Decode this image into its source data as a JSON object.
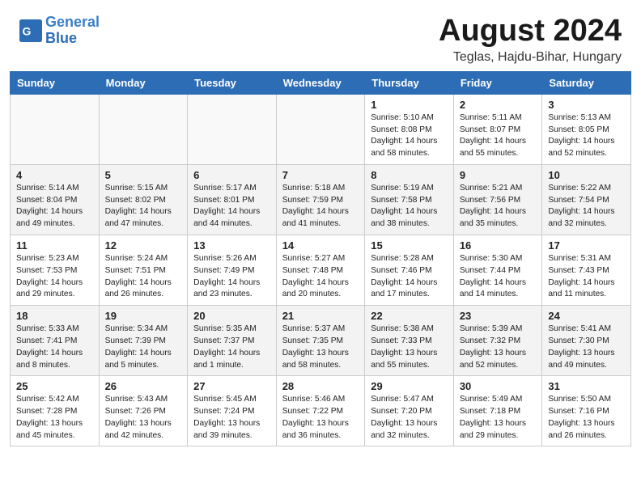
{
  "header": {
    "logo_line1": "General",
    "logo_line2": "Blue",
    "title": "August 2024",
    "subtitle": "Teglas, Hajdu-Bihar, Hungary"
  },
  "weekdays": [
    "Sunday",
    "Monday",
    "Tuesday",
    "Wednesday",
    "Thursday",
    "Friday",
    "Saturday"
  ],
  "weeks": [
    [
      {
        "day": "",
        "info": ""
      },
      {
        "day": "",
        "info": ""
      },
      {
        "day": "",
        "info": ""
      },
      {
        "day": "",
        "info": ""
      },
      {
        "day": "1",
        "info": "Sunrise: 5:10 AM\nSunset: 8:08 PM\nDaylight: 14 hours\nand 58 minutes."
      },
      {
        "day": "2",
        "info": "Sunrise: 5:11 AM\nSunset: 8:07 PM\nDaylight: 14 hours\nand 55 minutes."
      },
      {
        "day": "3",
        "info": "Sunrise: 5:13 AM\nSunset: 8:05 PM\nDaylight: 14 hours\nand 52 minutes."
      }
    ],
    [
      {
        "day": "4",
        "info": "Sunrise: 5:14 AM\nSunset: 8:04 PM\nDaylight: 14 hours\nand 49 minutes."
      },
      {
        "day": "5",
        "info": "Sunrise: 5:15 AM\nSunset: 8:02 PM\nDaylight: 14 hours\nand 47 minutes."
      },
      {
        "day": "6",
        "info": "Sunrise: 5:17 AM\nSunset: 8:01 PM\nDaylight: 14 hours\nand 44 minutes."
      },
      {
        "day": "7",
        "info": "Sunrise: 5:18 AM\nSunset: 7:59 PM\nDaylight: 14 hours\nand 41 minutes."
      },
      {
        "day": "8",
        "info": "Sunrise: 5:19 AM\nSunset: 7:58 PM\nDaylight: 14 hours\nand 38 minutes."
      },
      {
        "day": "9",
        "info": "Sunrise: 5:21 AM\nSunset: 7:56 PM\nDaylight: 14 hours\nand 35 minutes."
      },
      {
        "day": "10",
        "info": "Sunrise: 5:22 AM\nSunset: 7:54 PM\nDaylight: 14 hours\nand 32 minutes."
      }
    ],
    [
      {
        "day": "11",
        "info": "Sunrise: 5:23 AM\nSunset: 7:53 PM\nDaylight: 14 hours\nand 29 minutes."
      },
      {
        "day": "12",
        "info": "Sunrise: 5:24 AM\nSunset: 7:51 PM\nDaylight: 14 hours\nand 26 minutes."
      },
      {
        "day": "13",
        "info": "Sunrise: 5:26 AM\nSunset: 7:49 PM\nDaylight: 14 hours\nand 23 minutes."
      },
      {
        "day": "14",
        "info": "Sunrise: 5:27 AM\nSunset: 7:48 PM\nDaylight: 14 hours\nand 20 minutes."
      },
      {
        "day": "15",
        "info": "Sunrise: 5:28 AM\nSunset: 7:46 PM\nDaylight: 14 hours\nand 17 minutes."
      },
      {
        "day": "16",
        "info": "Sunrise: 5:30 AM\nSunset: 7:44 PM\nDaylight: 14 hours\nand 14 minutes."
      },
      {
        "day": "17",
        "info": "Sunrise: 5:31 AM\nSunset: 7:43 PM\nDaylight: 14 hours\nand 11 minutes."
      }
    ],
    [
      {
        "day": "18",
        "info": "Sunrise: 5:33 AM\nSunset: 7:41 PM\nDaylight: 14 hours\nand 8 minutes."
      },
      {
        "day": "19",
        "info": "Sunrise: 5:34 AM\nSunset: 7:39 PM\nDaylight: 14 hours\nand 5 minutes."
      },
      {
        "day": "20",
        "info": "Sunrise: 5:35 AM\nSunset: 7:37 PM\nDaylight: 14 hours\nand 1 minute."
      },
      {
        "day": "21",
        "info": "Sunrise: 5:37 AM\nSunset: 7:35 PM\nDaylight: 13 hours\nand 58 minutes."
      },
      {
        "day": "22",
        "info": "Sunrise: 5:38 AM\nSunset: 7:33 PM\nDaylight: 13 hours\nand 55 minutes."
      },
      {
        "day": "23",
        "info": "Sunrise: 5:39 AM\nSunset: 7:32 PM\nDaylight: 13 hours\nand 52 minutes."
      },
      {
        "day": "24",
        "info": "Sunrise: 5:41 AM\nSunset: 7:30 PM\nDaylight: 13 hours\nand 49 minutes."
      }
    ],
    [
      {
        "day": "25",
        "info": "Sunrise: 5:42 AM\nSunset: 7:28 PM\nDaylight: 13 hours\nand 45 minutes."
      },
      {
        "day": "26",
        "info": "Sunrise: 5:43 AM\nSunset: 7:26 PM\nDaylight: 13 hours\nand 42 minutes."
      },
      {
        "day": "27",
        "info": "Sunrise: 5:45 AM\nSunset: 7:24 PM\nDaylight: 13 hours\nand 39 minutes."
      },
      {
        "day": "28",
        "info": "Sunrise: 5:46 AM\nSunset: 7:22 PM\nDaylight: 13 hours\nand 36 minutes."
      },
      {
        "day": "29",
        "info": "Sunrise: 5:47 AM\nSunset: 7:20 PM\nDaylight: 13 hours\nand 32 minutes."
      },
      {
        "day": "30",
        "info": "Sunrise: 5:49 AM\nSunset: 7:18 PM\nDaylight: 13 hours\nand 29 minutes."
      },
      {
        "day": "31",
        "info": "Sunrise: 5:50 AM\nSunset: 7:16 PM\nDaylight: 13 hours\nand 26 minutes."
      }
    ]
  ]
}
